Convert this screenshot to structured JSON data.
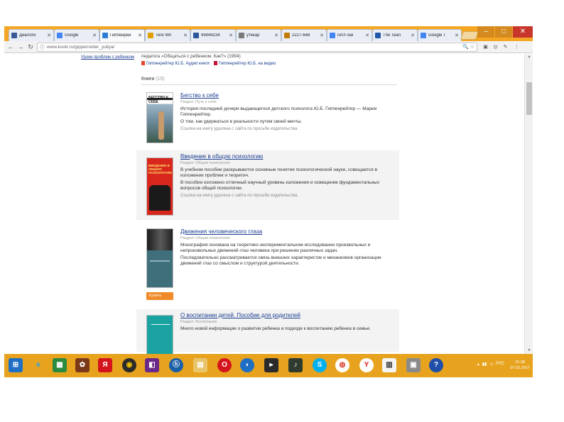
{
  "browser": {
    "tabs": [
      {
        "label": "Диалоги",
        "color": "#3b5998"
      },
      {
        "label": "Google",
        "color": "#4285f4"
      },
      {
        "label": "Гиппенрей",
        "color": "#2a7fd4"
      },
      {
        "label": "Tere Wri",
        "color": "#e0a000"
      },
      {
        "label": "99949234",
        "color": "#2b579a"
      },
      {
        "label": "утекар",
        "color": "#7a7a7a"
      },
      {
        "label": "2227-648",
        "color": "#c47a00"
      },
      {
        "label": "гитл ски",
        "color": "#4285f4"
      },
      {
        "label": "The Tean",
        "color": "#1e5aa8"
      },
      {
        "label": "Google T",
        "color": "#4285f4"
      }
    ],
    "url": "www.koob.ru/gippenreiter_yuliya/",
    "window_controls": {
      "minimize": "–",
      "maximize": "□",
      "close": "✕"
    }
  },
  "page": {
    "left_link": "Уроки проблем с ребенком",
    "intro": "педагога «Общаться с ребенком. Как?» (1994)",
    "downloads": [
      {
        "label": "Гиппенрейтер Ю.Б. Аудио книги",
        "color": "#e8432e"
      },
      {
        "label": "Гиппенрейтер Ю.Б. на видео",
        "color": "#c0143c"
      }
    ],
    "books_label": "Книги",
    "books_count": "(15)",
    "books": [
      {
        "title": "Бегство к себе",
        "section": "Раздел: Путь к себе",
        "desc": "История последней дочери выдающегося детского психолога Ю.Б. Гиппенрейтер — Марии Гиппенрейтер.",
        "desc2": "О том, как удержаться в реальности путем своей мечты.",
        "note": "Ссылка на книгу удалена с сайта по просьбе издательства.",
        "cover_label": "БЕГСТВО К СЕБЕ",
        "shaded": false
      },
      {
        "title": "Введение в общую психологию",
        "section": "Раздел: Общая психология",
        "desc": "В учебном пособии раскрываются основные понятия психологической науки, совещается в изложении проблем и теоретич.",
        "desc2": "В пособии изложено отличный научный уровень изложения и освещение фундаментальных вопросов общей психологии.",
        "note": "Ссылка на книгу удалена с сайта по просьбе издательства.",
        "cover_label": "ВВЕДЕНИЕ В ОБЩУЮ ПСИХОЛОГИЮ",
        "shaded": true
      },
      {
        "title": "Движения человеческого глаза",
        "section": "Раздел: Общая психология",
        "desc": "Монография основана на теоретико-экспериментальном исследовании произвольных и непроизвольных движений глаз человека при решении различных задач.",
        "desc2": "Последовательно рассматривается связь внешних характеристик и механизмов организации движений глаз со смыслом и структурой деятельности.",
        "note": "",
        "cover_label": "",
        "buy": "Купить",
        "shaded": false
      },
      {
        "title": "О воспитании детей. Пособие для родителей",
        "section": "Раздел: Воспитание",
        "desc": "Много новой информации о развитии ребенка и подходе к воспитанию ребенка в семье.",
        "desc2": "",
        "note": "",
        "cover_label": "",
        "shaded": true
      }
    ]
  },
  "taskbar": {
    "apps": [
      "windows-start",
      "ie",
      "calculator",
      "photos",
      "yandex",
      "media",
      "remote",
      "hp",
      "explorer",
      "opera",
      "lync",
      "player",
      "winamp",
      "skype",
      "chrome",
      "yandex-browser",
      "clipboard",
      "diskette",
      "help"
    ],
    "tray": "РУС",
    "time": "21:38",
    "date": "07.02.2017"
  }
}
